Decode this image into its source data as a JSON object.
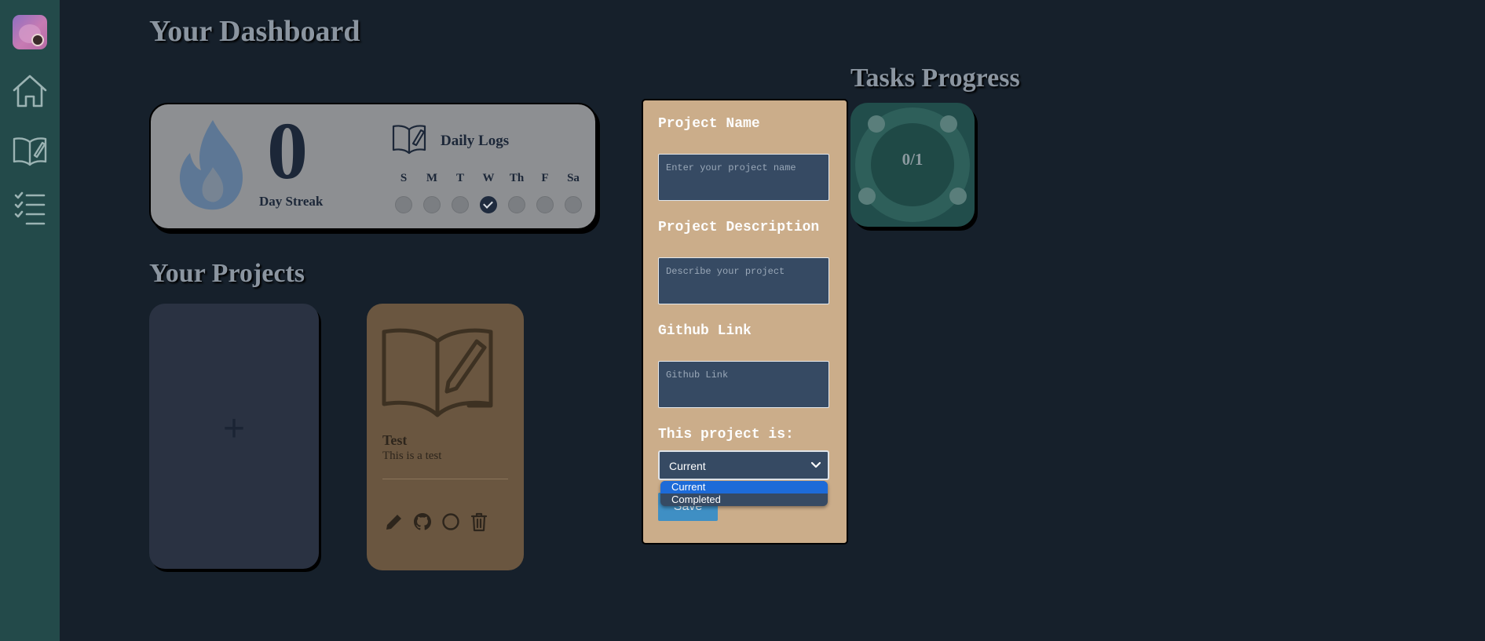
{
  "colors": {
    "background": "#16202b",
    "sidebar": "#234a4a",
    "modal": "#cbad8a",
    "accent_blue": "#3f8fc4",
    "card_gray": "#8d8f92",
    "project_card": "#6a5640"
  },
  "sidebar": {
    "avatar": "user-avatar",
    "items": [
      {
        "icon": "home-icon"
      },
      {
        "icon": "book-icon"
      },
      {
        "icon": "checklist-icon"
      }
    ]
  },
  "dashboard": {
    "title": "Your Dashboard",
    "streak": {
      "value": "0",
      "label": "Day Streak",
      "icon": "flame-icon"
    },
    "daily_logs": {
      "title": "Daily Logs",
      "icon": "open-book-pen-icon",
      "days": [
        {
          "label": "S",
          "done": false
        },
        {
          "label": "M",
          "done": false
        },
        {
          "label": "T",
          "done": false
        },
        {
          "label": "W",
          "done": true
        },
        {
          "label": "Th",
          "done": false
        },
        {
          "label": "F",
          "done": false
        },
        {
          "label": "Sa",
          "done": false
        }
      ]
    }
  },
  "tasks": {
    "title": "Tasks Progress",
    "progress_text": "0/1",
    "completed": 0,
    "total": 1
  },
  "projects": {
    "title": "Your Projects",
    "add_symbol": "+",
    "items": [
      {
        "title": "Test",
        "description": "This is a test",
        "icon": "open-book-pen-icon",
        "actions": [
          "pencil-icon",
          "github-icon",
          "circle-icon",
          "trash-icon"
        ]
      }
    ]
  },
  "modal": {
    "name_label": "Project Name",
    "name_placeholder": "Enter your project name",
    "name_value": "",
    "desc_label": "Project Description",
    "desc_placeholder": "Describe your project",
    "desc_value": "",
    "github_label": "Github Link",
    "github_placeholder": "Github Link",
    "github_value": "",
    "status_label": "This project is:",
    "status_value": "Current",
    "status_options": [
      "Current",
      "Completed"
    ],
    "save_label": "Save"
  }
}
